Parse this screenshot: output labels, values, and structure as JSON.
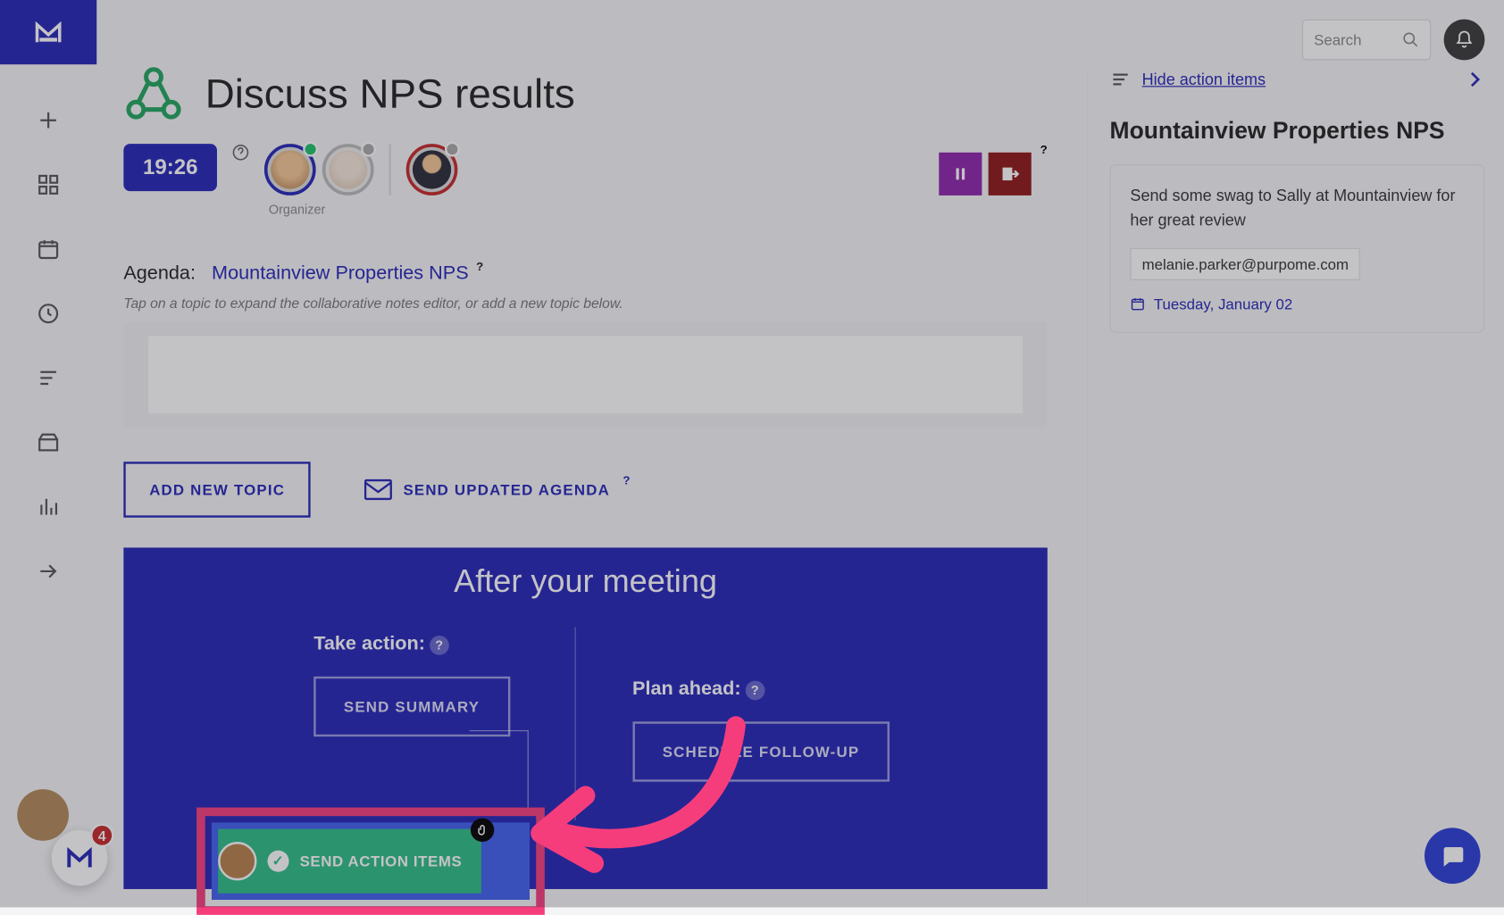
{
  "search": {
    "placeholder": "Search"
  },
  "meeting": {
    "title": "Discuss NPS results",
    "timer": "19:26",
    "organizer_label": "Organizer",
    "agenda_label": "Agenda:",
    "agenda_topic": "Mountainview Properties NPS",
    "agenda_hint": "Tap on a topic to expand the collaborative notes editor, or add a new topic below.",
    "add_topic_label": "ADD NEW TOPIC",
    "send_agenda_label": "SEND UPDATED AGENDA"
  },
  "after": {
    "heading": "After your meeting",
    "take_action_label": "Take action:",
    "plan_ahead_label": "Plan ahead:",
    "send_summary": "SEND SUMMARY",
    "send_action_items": "SEND ACTION ITEMS",
    "schedule_followup": "SCHEDULE FOLLOW-UP"
  },
  "right": {
    "hide_link": "Hide action items",
    "title": "Mountainview Properties NPS",
    "card": {
      "text": "Send some swag to Sally at Mountainview for her great review",
      "email": "melanie.parker@purpome.com",
      "date": "Tuesday, January 02"
    }
  },
  "badges": {
    "portal_count": "4"
  }
}
